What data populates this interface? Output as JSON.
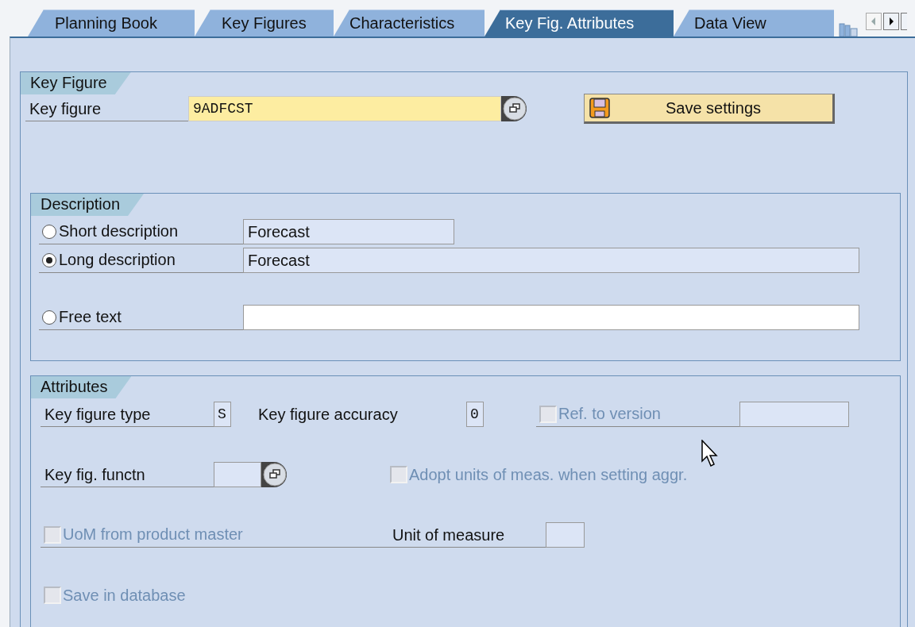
{
  "tabs": [
    {
      "label": "Planning Book",
      "selected": false
    },
    {
      "label": "Key Figures",
      "selected": false
    },
    {
      "label": "Characteristics",
      "selected": false
    },
    {
      "label": "Key Fig. Attributes",
      "selected": true
    },
    {
      "label": "Data View",
      "selected": false
    }
  ],
  "key_figure_group": {
    "title": "Key Figure",
    "field": {
      "label": "Key figure",
      "value": "9ADFCST"
    },
    "save_button": {
      "label": "Save settings"
    }
  },
  "description_group": {
    "title": "Description",
    "options": [
      {
        "label": "Short description",
        "selected": false,
        "value": "Forecast",
        "editable": false,
        "kind": "short"
      },
      {
        "label": "Long description",
        "selected": true,
        "value": "Forecast",
        "editable": false,
        "kind": "long"
      },
      {
        "label": "Free text",
        "selected": false,
        "editable": true,
        "kind": "long"
      }
    ]
  },
  "attributes_group": {
    "title": "Attributes",
    "key_figure_type": {
      "label": "Key figure type",
      "value": "S"
    },
    "key_figure_accuracy": {
      "label": "Key figure accuracy",
      "value": "0"
    },
    "ref_to_version": {
      "label": "Ref. to version",
      "checked": false,
      "disabled": true
    },
    "key_fig_function": {
      "label": "Key fig. functn"
    },
    "adopt_units": {
      "label": "Adopt units of meas. when setting aggr.",
      "checked": false,
      "disabled": true
    },
    "uom_from_product_master": {
      "label": "UoM from product master",
      "checked": false,
      "disabled": true
    },
    "unit_of_measure": {
      "label": "Unit of measure"
    },
    "save_in_database": {
      "label": "Save in database",
      "checked": false,
      "disabled": true
    }
  }
}
